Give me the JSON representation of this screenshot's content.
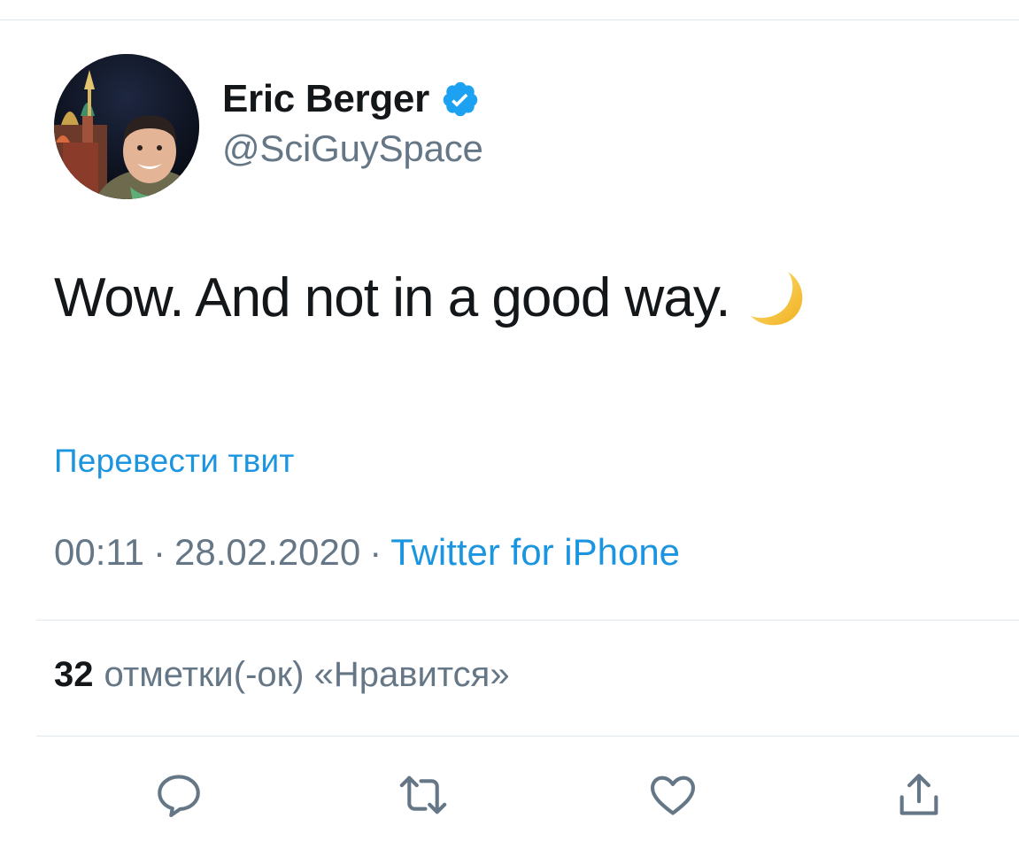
{
  "author": {
    "display_name": "Eric Berger",
    "handle": "@SciGuySpace",
    "verified": true,
    "avatar_icon": "profile-photo"
  },
  "tweet": {
    "text": "Wow. And not in a good way.",
    "emoji_icon": "crescent-moon-emoji"
  },
  "translate_label": "Перевести твит",
  "meta": {
    "time": "00:11",
    "separator": "·",
    "date": "28.02.2020",
    "source": "Twitter for iPhone"
  },
  "likes": {
    "count": "32",
    "label": "отметки(-ок) «Нравится»"
  },
  "actions": {
    "reply_icon": "reply-icon",
    "retweet_icon": "retweet-icon",
    "like_icon": "heart-icon",
    "share_icon": "share-icon"
  },
  "colors": {
    "link": "#1b95e0",
    "muted": "#657786",
    "text": "#14171a",
    "divider": "#e1e8ed",
    "verified": "#1da1f2"
  }
}
